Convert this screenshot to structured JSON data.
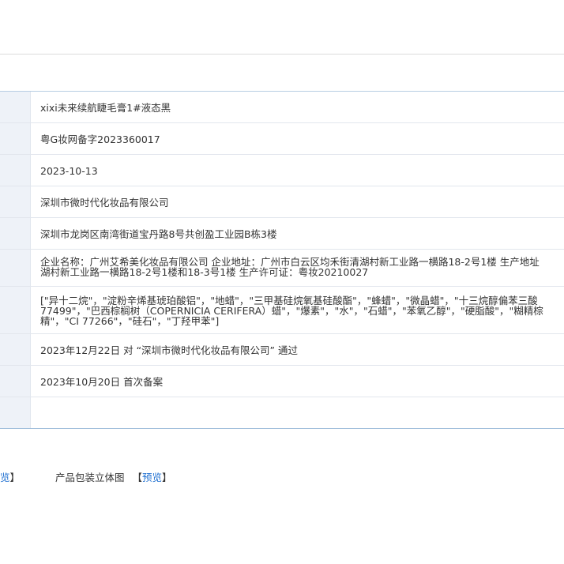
{
  "rows": [
    {
      "value": "xixi未来续航睫毛膏1#液态黑"
    },
    {
      "value": "粤G妆网备字2023360017"
    },
    {
      "value": "2023-10-13"
    },
    {
      "value": "深圳市微时代化妆品有限公司"
    },
    {
      "value": "深圳市龙岗区南湾街道宝丹路8号共创盈工业园B栋3楼"
    },
    {
      "lines": [
        "企业名称：广州艾希美化妆品有限公司 企业地址：广州市白云区均禾街清湖村新工业路一横路18-2号1楼 生产地址",
        "湖村新工业路一横路18-2号1楼和18-3号1楼 生产许可证：粤妆20210027"
      ]
    },
    {
      "lines": [
        "[\"异十二烷\"，\"淀粉辛烯基琥珀酸铝\"，\"地蜡\"，\"三甲基硅烷氧基硅酸酯\"，\"蜂蜡\"，\"微晶蜡\"，\"十三烷醇偏苯三酸",
        "77499\"，\"巴西棕榈树（COPERNICIA CERIFERA）蜡\"，\"爆素\"，\"水\"，\"石蜡\"，\"苯氧乙醇\"，\"硬脂酸\"，\"糊精棕",
        "精\"，\"CI 77266\"，\"硅石\"，\"丁羟甲苯\"]"
      ]
    },
    {
      "value": "2023年12月22日 对 “深圳市微时代化妆品有限公司” 通过"
    },
    {
      "value": "2023年10月20日 首次备案"
    },
    {
      "value": ""
    }
  ],
  "footer": {
    "partial_link_text": "览",
    "partial_bracket_close": "】",
    "package_label": "产品包装立体图",
    "bracket_open": "【",
    "preview_link": "预览",
    "bracket_close": "】"
  }
}
